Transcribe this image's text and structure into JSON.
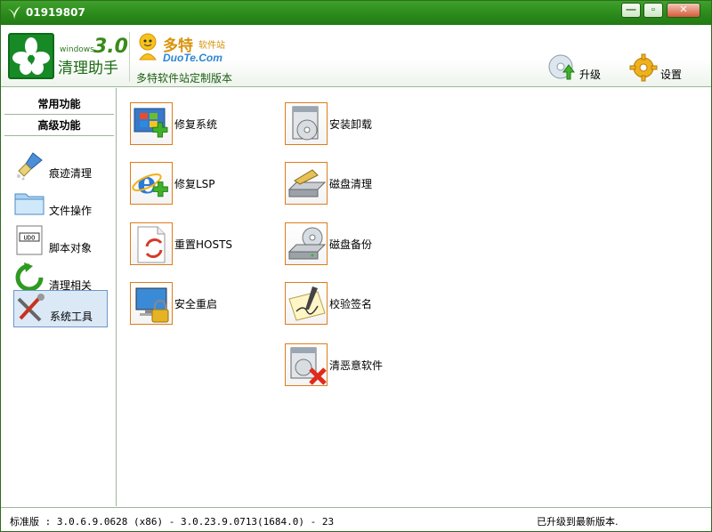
{
  "window": {
    "title": "01919807"
  },
  "header": {
    "logo_small": "windows",
    "logo_version": "3.0",
    "logo_name": "清理助手",
    "partner_name": "多特",
    "partner_suffix": "软件站",
    "partner_domain": "DuoTe.Com",
    "custom_label": "多特软件站定制版本",
    "upgrade_label": "升级",
    "settings_label": "设置"
  },
  "sidebar": {
    "tabs": [
      {
        "label": "常用功能"
      },
      {
        "label": "高级功能"
      }
    ],
    "items": [
      {
        "label": "痕迹清理",
        "icon": "brush-icon"
      },
      {
        "label": "文件操作",
        "icon": "folder-icon"
      },
      {
        "label": "脚本对象",
        "icon": "script-icon"
      },
      {
        "label": "清理相关",
        "icon": "refresh-icon"
      },
      {
        "label": "系统工具",
        "icon": "tools-icon",
        "active": true
      }
    ]
  },
  "tools": {
    "left": [
      {
        "label": "修复系统",
        "icon": "windows-repair-icon"
      },
      {
        "label": "修复LSP",
        "icon": "ie-repair-icon"
      },
      {
        "label": "重置HOSTS",
        "icon": "hosts-reset-icon"
      },
      {
        "label": "安全重启",
        "icon": "secure-restart-icon"
      }
    ],
    "right": [
      {
        "label": "安装卸载",
        "icon": "install-uninstall-icon"
      },
      {
        "label": "磁盘清理",
        "icon": "disk-clean-icon"
      },
      {
        "label": "磁盘备份",
        "icon": "disk-backup-icon"
      },
      {
        "label": "校验签名",
        "icon": "verify-signature-icon"
      },
      {
        "label": "清恶意软件",
        "icon": "malware-remove-icon"
      }
    ]
  },
  "status": {
    "version_text": "标准版 : 3.0.6.9.0628 (x86) - 3.0.23.9.0713(1684.0) - 23",
    "update_text": "已升级到最新版本."
  },
  "colors": {
    "titlebar": "#2b8a1b",
    "accent_border": "#e07c1a",
    "active_item_bg": "#dbe9f7"
  }
}
